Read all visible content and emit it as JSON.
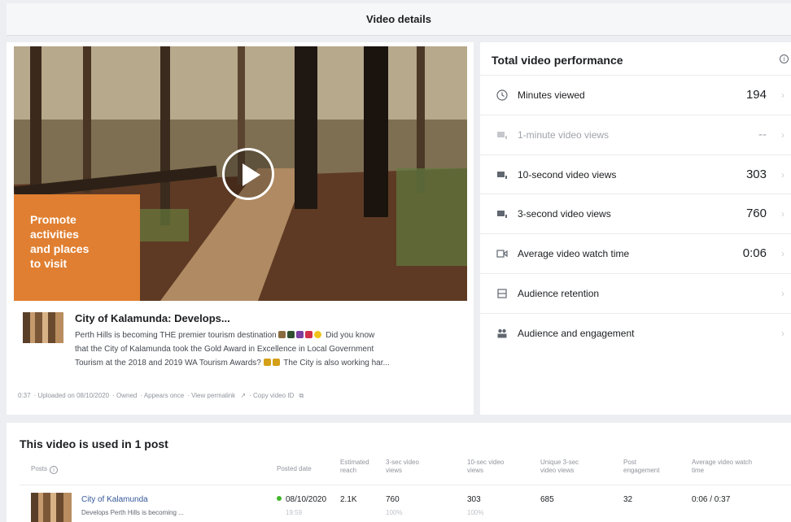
{
  "header": {
    "title": "Video details"
  },
  "player": {
    "promo_lines": [
      "Promote",
      "activities",
      "and places",
      "to visit"
    ]
  },
  "video": {
    "title": "City of Kalamunda: Develops...",
    "desc_line1": "Perth Hills is becoming THE premier tourism destination",
    "desc_line1_tail": "Did you know",
    "desc_line2": "that the City of Kalamunda took the Gold Award in Excellence in Local Government",
    "desc_line3_head": "Tourism at the 2018 and 2019 WA Tourism Awards?",
    "desc_line3_tail": "The City is also working har...",
    "meta": {
      "duration": "0:37",
      "uploaded": "Uploaded on 08/10/2020",
      "owned": "Owned",
      "appears": "Appears once",
      "permalink": "View permalink",
      "copy_id": "Copy video ID"
    }
  },
  "performance": {
    "title": "Total video performance",
    "info_glyph": "i",
    "metrics": [
      {
        "label": "Minutes viewed",
        "value": "194",
        "icon": "clock-icon",
        "dim": false
      },
      {
        "label": "1-minute video views",
        "value": "--",
        "icon": "video-views-icon",
        "dim": true
      },
      {
        "label": "10-second video views",
        "value": "303",
        "icon": "video-views-icon",
        "dim": false
      },
      {
        "label": "3-second video views",
        "value": "760",
        "icon": "video-views-icon",
        "dim": false
      },
      {
        "label": "Average video watch time",
        "value": "0:06",
        "icon": "video-camera-icon",
        "dim": false
      },
      {
        "label": "Audience retention",
        "value": "",
        "icon": "retention-icon",
        "dim": false
      },
      {
        "label": "Audience and engagement",
        "value": "",
        "icon": "people-icon",
        "dim": false
      }
    ],
    "chevron": "›"
  },
  "posts": {
    "title": "This video is used in 1 post",
    "columns": {
      "posts": "Posts",
      "posted_date": "Posted date",
      "est_reach_1": "Estimated",
      "est_reach_2": "reach",
      "three_sec_1": "3-sec video",
      "three_sec_2": "views",
      "ten_sec_1": "10-sec video",
      "ten_sec_2": "views",
      "unique_1": "Unique 3-sec",
      "unique_2": "video views",
      "engagement_1": "Post",
      "engagement_2": "engagement",
      "avg_watch_1": "Average video watch",
      "avg_watch_2": "time"
    },
    "rows": [
      {
        "name": "City of Kalamunda",
        "excerpt": "Develops Perth Hills is becoming ...",
        "date": "08/10/2020",
        "time": "19:59",
        "reach": "2.1K",
        "three_sec": "760",
        "three_sec_pct": "100%",
        "ten_sec": "303",
        "ten_sec_pct": "100%",
        "unique": "685",
        "engagement": "32",
        "avg_watch": "0:06 / 0:37"
      }
    ]
  },
  "colors": {
    "promo": "#e07f31",
    "link": "#365899",
    "status": "#42b72a"
  }
}
